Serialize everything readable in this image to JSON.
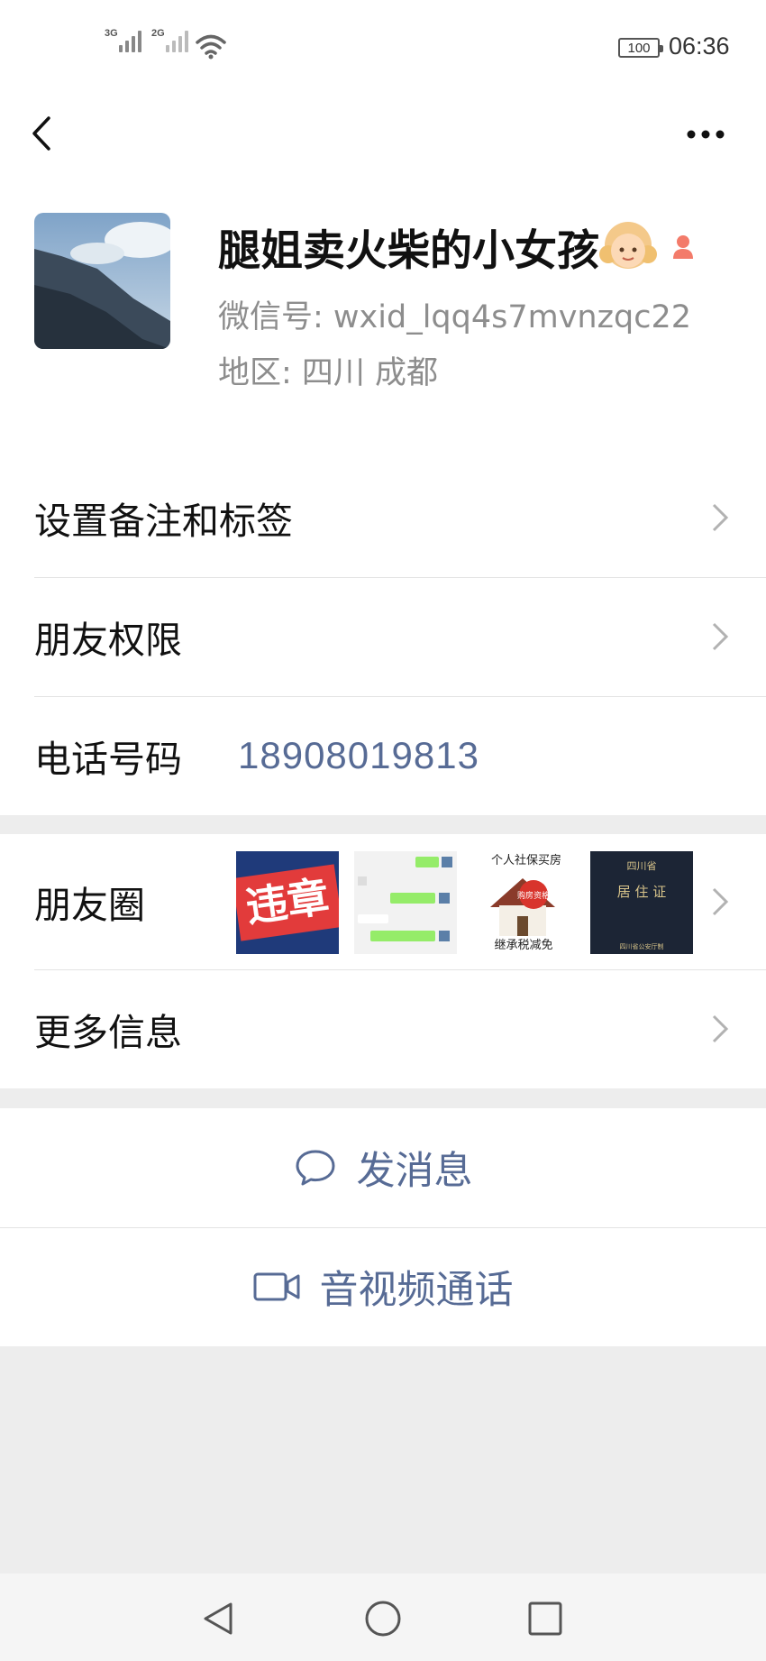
{
  "status_bar": {
    "signal1_label": "3G",
    "signal2_label": "2G",
    "battery": "100",
    "time": "06:36"
  },
  "profile": {
    "name": "腿姐卖火柴的小女孩",
    "wechat_id": "微信号: wxid_lqq4s7mvnzqc22",
    "region": "地区: 四川  成都",
    "gender_icon": "female-icon",
    "name_emoji": "girl-emoji-icon"
  },
  "menu": {
    "remark_tags": "设置备注和标签",
    "friend_permissions": "朋友权限",
    "phone_label": "电话号码",
    "phone_value": "18908019813",
    "moments": "朋友圈",
    "more_info": "更多信息"
  },
  "moments_thumbs": {
    "t1": "违章",
    "t3_line1": "个人社保买房",
    "t3_badge": "购房资格",
    "t3_line2": "继承税减免",
    "t4_province": "四川省",
    "t4_title": "居 住 证",
    "t4_footer": "四川省公安厅制"
  },
  "actions": {
    "send_message": "发消息",
    "video_call": "音视频通话"
  },
  "colors": {
    "link": "#576b95",
    "background": "#ededed"
  }
}
